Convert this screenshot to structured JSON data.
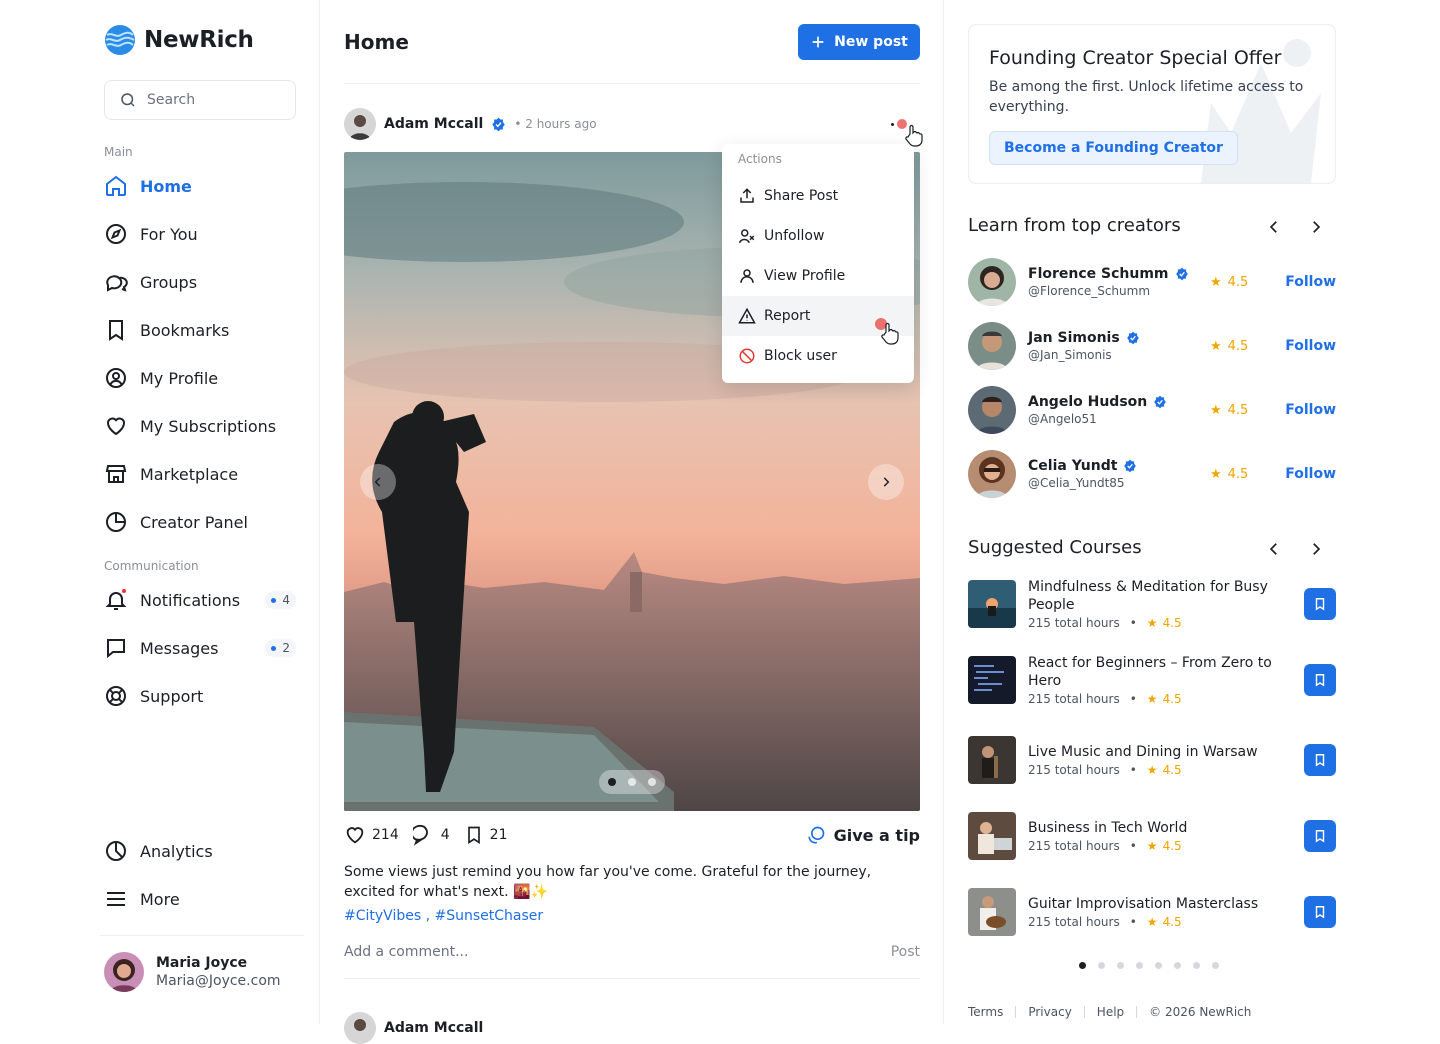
{
  "app": {
    "name": "NewRich"
  },
  "sidebar": {
    "search_placeholder": "Search",
    "section_main": "Main",
    "section_communication": "Communication",
    "items": [
      {
        "label": "Home",
        "icon": "home-icon"
      },
      {
        "label": "For You",
        "icon": "compass-icon"
      },
      {
        "label": "Groups",
        "icon": "groups-icon"
      },
      {
        "label": "Bookmarks",
        "icon": "bookmark-icon"
      },
      {
        "label": "My Profile",
        "icon": "user-circle-icon"
      },
      {
        "label": "My Subscriptions",
        "icon": "heart-icon"
      },
      {
        "label": "Marketplace",
        "icon": "store-icon"
      },
      {
        "label": "Creator Panel",
        "icon": "pie-chart-icon"
      }
    ],
    "comm_items": [
      {
        "label": "Notifications",
        "icon": "bell-icon",
        "badge": "4"
      },
      {
        "label": "Messages",
        "icon": "message-icon",
        "badge": "2"
      },
      {
        "label": "Support",
        "icon": "lifebuoy-icon"
      }
    ],
    "bottom_items": [
      {
        "label": "Analytics",
        "icon": "analytics-icon"
      },
      {
        "label": "More",
        "icon": "menu-icon"
      }
    ],
    "user": {
      "name": "Maria Joyce",
      "email": "Maria@Joyce.com"
    }
  },
  "main": {
    "title": "Home",
    "new_post_label": "New post",
    "post": {
      "author": "Adam Mccall",
      "time": "2 hours ago",
      "likes": "214",
      "comments": "4",
      "saves": "21",
      "tip_label": "Give a tip",
      "text": "Some views just remind you how far you've come. Grateful for the journey, excited for what's next. 🌇✨",
      "hashtag_1": "#CityVibes",
      "hashtag_sep": ",",
      "hashtag_2": "#SunsetChaser",
      "comment_placeholder": "Add a comment...",
      "comment_post_label": "Post",
      "image_index": 1,
      "image_count": 3
    },
    "menu": {
      "title": "Actions",
      "items": [
        {
          "label": "Share Post",
          "icon": "share-icon"
        },
        {
          "label": "Unfollow",
          "icon": "user-x-icon"
        },
        {
          "label": "View Profile",
          "icon": "user-icon"
        },
        {
          "label": "Report",
          "icon": "warning-icon"
        },
        {
          "label": "Block user",
          "icon": "block-icon"
        }
      ]
    }
  },
  "right": {
    "promo": {
      "title": "Founding Creator Special Offer",
      "text": "Be among the first. Unlock lifetime access to everything.",
      "button": "Become a Founding Creator"
    },
    "creators_title": "Learn from top creators",
    "creators": [
      {
        "name": "Florence Schumm",
        "handle": "@Florence_Schumm",
        "rating": "4.5",
        "follow": "Follow"
      },
      {
        "name": "Jan Simonis",
        "handle": "@Jan_Simonis",
        "rating": "4.5",
        "follow": "Follow"
      },
      {
        "name": "Angelo Hudson",
        "handle": "@Angelo51",
        "rating": "4.5",
        "follow": "Follow"
      },
      {
        "name": "Celia Yundt",
        "handle": "@Celia_Yundt85",
        "rating": "4.5",
        "follow": "Follow"
      }
    ],
    "courses_title": "Suggested Courses",
    "courses": [
      {
        "title": "Mindfulness & Meditation for Busy People",
        "hours": "215 total hours",
        "rating": "4.5"
      },
      {
        "title": "React for Beginners – From Zero to Hero",
        "hours": "215 total hours",
        "rating": "4.5"
      },
      {
        "title": "Live Music and Dining in Warsaw",
        "hours": "215 total hours",
        "rating": "4.5"
      },
      {
        "title": "Business in Tech World",
        "hours": "215 total hours",
        "rating": "4.5"
      },
      {
        "title": "Guitar Improvisation Masterclass",
        "hours": "215 total hours",
        "rating": "4.5"
      }
    ],
    "courses_page": 1,
    "courses_pages": 8,
    "footer": {
      "terms": "Terms",
      "privacy": "Privacy",
      "help": "Help",
      "copyright": "© 2026 NewRich"
    }
  },
  "colors": {
    "accent": "#1f6fe5",
    "star": "#f0a500",
    "danger": "#e53935"
  }
}
